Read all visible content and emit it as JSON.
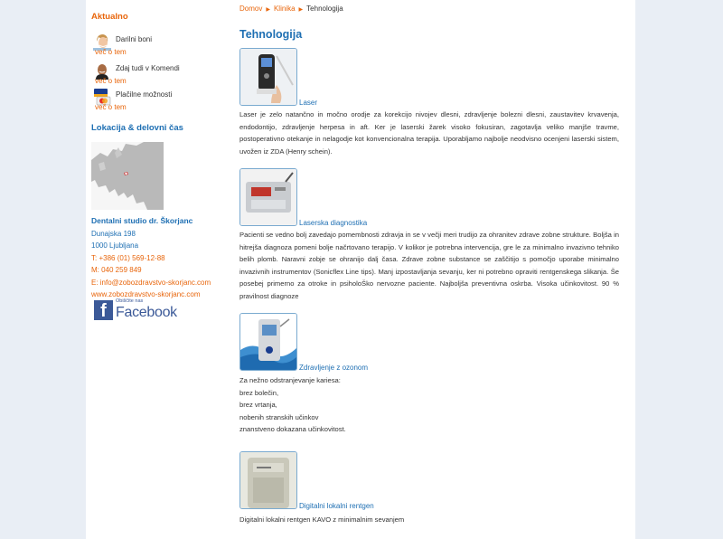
{
  "sidebar": {
    "news_heading": "Aktualno",
    "news": [
      {
        "title": "Darilni boni",
        "more": "več o tem",
        "icon": "woman-avatar-icon"
      },
      {
        "title": "Zdaj tudi v Komendi",
        "more": "več o tem",
        "icon": "man-avatar-icon"
      },
      {
        "title": "Plačilne možnosti",
        "more": "več o tem",
        "icon": "credit-cards-icon"
      }
    ],
    "location_heading": "Lokacija & delovni čas",
    "contact": {
      "name": "Dentalni studio dr. Škorjanc",
      "street": "Dunajska 198",
      "city": "1000 Ljubljana",
      "phone": "T: +386 (01) 569-12-88",
      "mobile": "M: 040 259 849",
      "email": "E: info@zobozdravstvo-skorjanc.com",
      "website": "www.zobozdravstvo-skorjanc.com"
    },
    "facebook": {
      "small": "Obiščite nas",
      "word": "Facebook"
    }
  },
  "breadcrumb": {
    "home": "Domov",
    "section": "Klinika",
    "current": "Tehnologija"
  },
  "page_title": "Tehnologija",
  "items": [
    {
      "caption": "Laser",
      "text": "Laser je zelo natančno in močno orodje za korekcijo nivojev dlesni, zdravljenje bolezni dlesni, zaustavitev krvavenja, endodontijo, zdravljenje herpesa in aft. Ker je laserski žarek visoko fokusiran, zagotavlja veliko manjše travme, postoperativno otekanje in nelagodje kot konvencionalna terapija. Uporabljamo najbolje neodvisno ocenjeni laserski sistem, uvožen iz ZDA (Henry schein)."
    },
    {
      "caption": "Laserska diagnostika",
      "text": " Pacienti se vedno bolj zavedajo pomembnosti zdravja in se v večji meri trudijo za ohranitev zdrave zobne strukture.  Boljša in hitrejša diagnoza pomeni bolje načrtovano terapijo.  V kolikor je potrebna intervencija, gre le za minimalno invazivno tehniko belih plomb. Naravni zobje se ohranijo dalj časa.  Zdrave zobne substance se zaščitijo s pomočjo uporabe minimalno invazivnih instrumentov (Sonicflex Line tips).  Manj izpostavljanja sevanju, ker ni potrebno opraviti rentgenskega slikanja. Še posebej primerno za otroke in psiholoŠko nervozne paciente. Najboljša preventivna oskrba. Visoka učinkovitost. 90 % pravilnost diagnoze"
    },
    {
      "caption": "Zdravljenje z ozonom",
      "lines": [
        "Za nežno odstranjevanje kariesa:",
        "brez bolečin,",
        "brez vrtanja,",
        "nobenih stranskih učinkov",
        "znanstveno dokazana učinkovitost."
      ]
    },
    {
      "caption": "Digitalni lokalni rentgen",
      "text": "Digitalni lokalni rentgen KAVO z minimalnim sevanjem"
    }
  ],
  "colors": {
    "accent_orange": "#e8650b",
    "link_blue": "#1e6fb3",
    "background": "#e9eef5"
  }
}
